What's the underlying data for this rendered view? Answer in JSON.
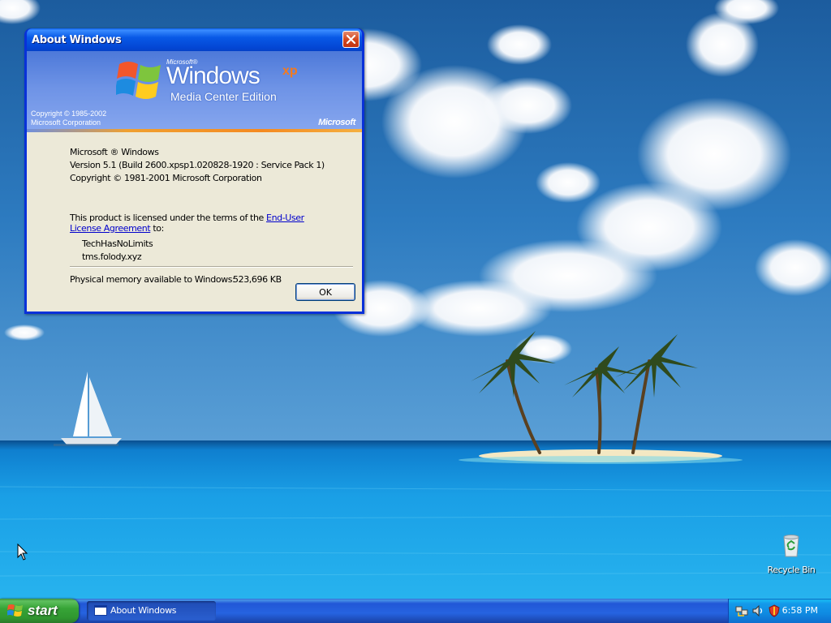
{
  "dialog": {
    "title": "About Windows",
    "banner": {
      "microsoft_small": "Microsoft®",
      "windows": "Windows",
      "xp": "xp",
      "edition": "Media Center Edition",
      "copyright_line1": "Copyright © 1985-2002",
      "copyright_line2": "Microsoft Corporation",
      "brand": "Microsoft"
    },
    "product_name": "Microsoft ® Windows",
    "version": "Version 5.1 (Build 2600.xpsp1.020828-1920 : Service Pack 1)",
    "copyright": "Copyright © 1981-2001 Microsoft Corporation",
    "license_prefix": "This product is licensed under the terms of the",
    "license_link_1": "End-User",
    "license_link_2": "License Agreement",
    "license_suffix": "to:",
    "licensee_name": "TechHasNoLimits",
    "licensee_org": "tms.folody.xyz",
    "memory_label": "Physical memory available to Windows:",
    "memory_value": "523,696 KB",
    "ok_label": "OK"
  },
  "desktop": {
    "recycle_bin_label": "Recycle Bin"
  },
  "taskbar": {
    "start_label": "start",
    "task_button_label": "About Windows",
    "clock": "6:58 PM",
    "tray_icons": [
      "network-icon",
      "volume-icon",
      "security-icon"
    ]
  },
  "colors": {
    "title_bar": "#0a5ff0",
    "start_button": "#37a437",
    "taskbar": "#2663e0",
    "tray": "#0f8be2",
    "dialog_face": "#ece9d8",
    "link": "#0000cc"
  }
}
